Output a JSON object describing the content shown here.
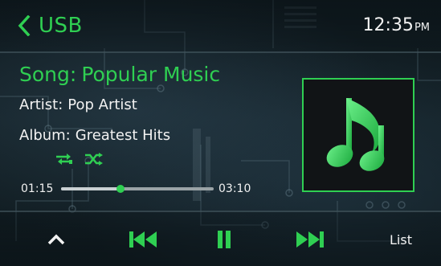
{
  "header": {
    "source": "USB",
    "time": "12:35",
    "ampm": "PM"
  },
  "track": {
    "song_label": "Song:",
    "song_title": "Popular Music",
    "artist_label": "Artist:",
    "artist": "Pop Artist",
    "album_label": "Album:",
    "album": "Greatest Hits",
    "elapsed": "01:15",
    "duration": "03:10",
    "progress_fraction": 0.39
  },
  "modes": {
    "repeat_icon": "repeat-one-icon",
    "shuffle_icon": "shuffle-icon"
  },
  "controls": {
    "up_icon": "chevron-up-icon",
    "prev_icon": "previous-track-icon",
    "pause_icon": "pause-icon",
    "next_icon": "next-track-icon",
    "list_label": "List"
  },
  "colors": {
    "accent": "#2fcf52",
    "text": "#f2f2f2",
    "background": "#142127"
  }
}
